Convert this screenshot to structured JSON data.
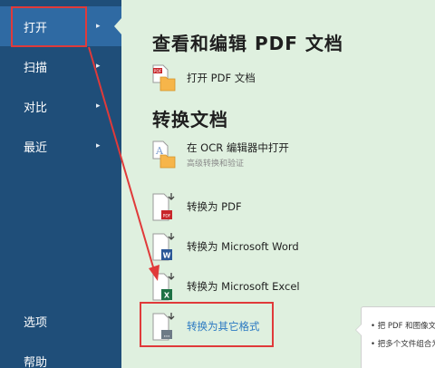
{
  "sidebar": {
    "items": [
      {
        "label": "打开",
        "chevron": "▸"
      },
      {
        "label": "扫描",
        "chevron": "▸"
      },
      {
        "label": "对比",
        "chevron": "▸"
      },
      {
        "label": "最近",
        "chevron": "▸"
      },
      {
        "label": "选项"
      },
      {
        "label": "帮助"
      }
    ]
  },
  "main": {
    "section_view": {
      "title": "查看和编辑 PDF 文档",
      "open_pdf": "打开 PDF 文档"
    },
    "section_convert": {
      "title": "转换文档",
      "ocr_open": "在 OCR 编辑器中打开",
      "ocr_sub": "高级转换和验证",
      "to_pdf": "转换为 PDF",
      "to_word": "转换为 Microsoft Word",
      "to_excel": "转换为 Microsoft Excel",
      "to_other": "转换为其它格式"
    },
    "icons": {
      "pdf_badge": "PDF",
      "word_badge": "W",
      "excel_badge": "X",
      "other_badge": "...",
      "ocr_letter": "A"
    }
  },
  "tooltip": {
    "line1": "• 把 PDF 和图像文",
    "line2": "• 把多个文件组合为"
  },
  "colors": {
    "sidebar": "#1f4e79",
    "sidebar_active": "#2f6aa3",
    "background": "#dff0df",
    "annotation_red": "#e03a3a",
    "link_blue": "#2b79c2"
  }
}
